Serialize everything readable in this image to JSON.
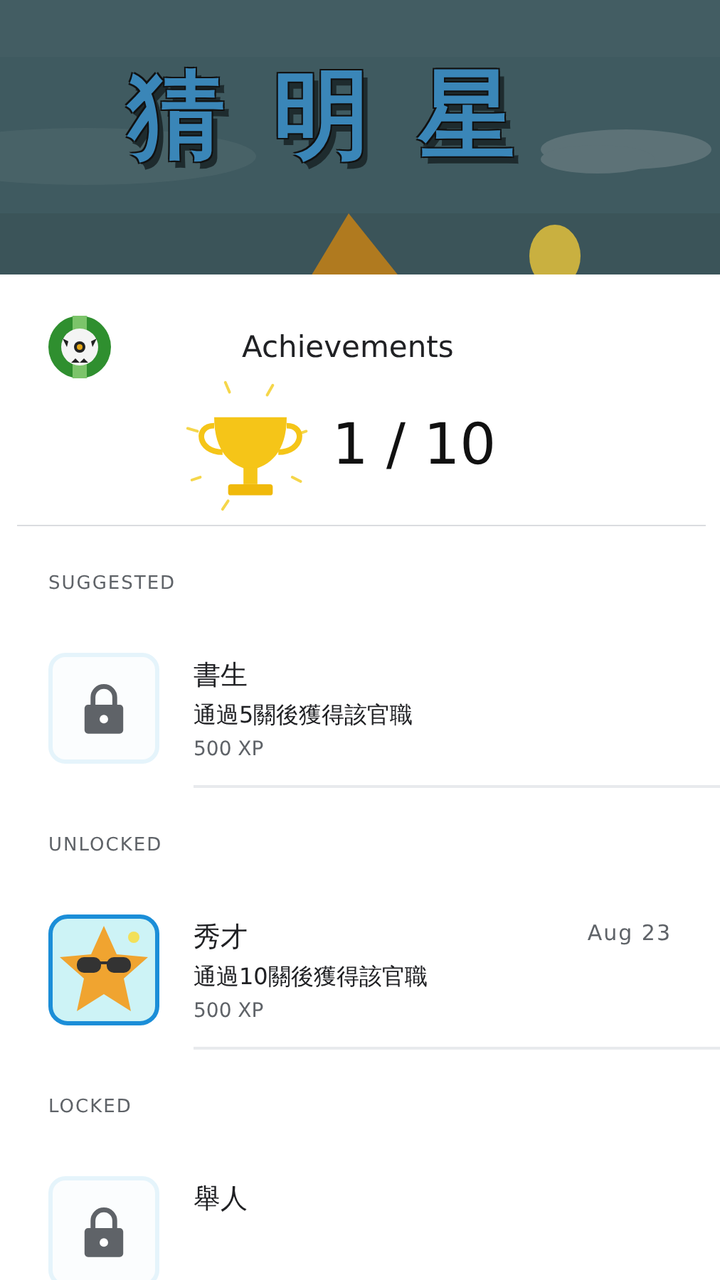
{
  "game_banner": {
    "title": "猜明星"
  },
  "header": {
    "title": "Achievements",
    "progress": "1 / 10"
  },
  "sections": [
    {
      "label": "SUGGESTED",
      "items": [
        {
          "kind": "locked",
          "title": "書生",
          "description": "通過5關後獲得該官職",
          "xp": "500 XP"
        }
      ]
    },
    {
      "label": "UNLOCKED",
      "items": [
        {
          "kind": "star",
          "title": "秀才",
          "description": "通過10關後獲得該官職",
          "xp": "500 XP",
          "date": "Aug 23"
        }
      ]
    },
    {
      "label": "LOCKED",
      "items": [
        {
          "kind": "locked",
          "title": "舉人"
        }
      ]
    }
  ]
}
